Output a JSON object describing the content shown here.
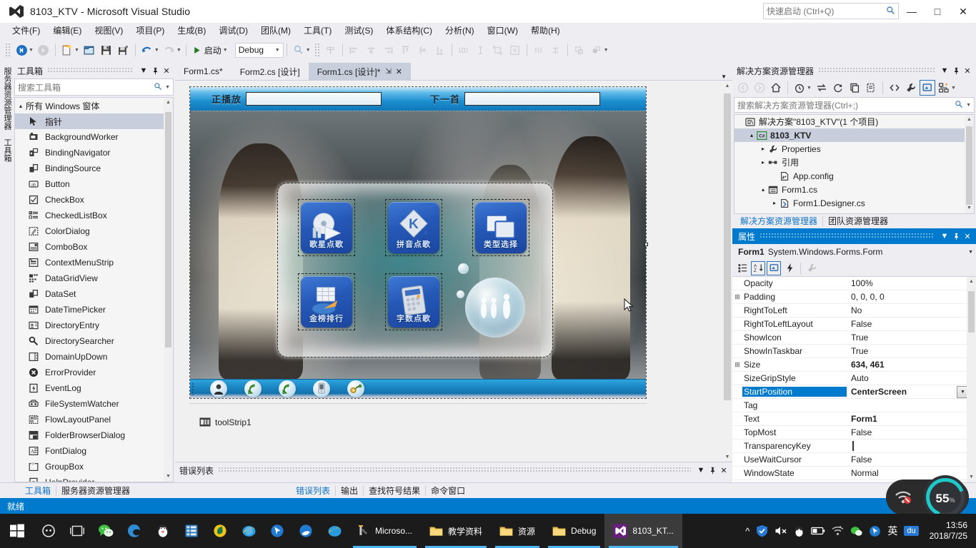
{
  "titlebar": {
    "title": "8103_KTV - Microsoft Visual Studio",
    "quick_launch_placeholder": "快速启动 (Ctrl+Q)",
    "minimize": "—",
    "maximize": "□",
    "close": "✕"
  },
  "menubar": {
    "items": [
      {
        "label": "文件(F)"
      },
      {
        "label": "编辑(E)"
      },
      {
        "label": "视图(V)"
      },
      {
        "label": "项目(P)"
      },
      {
        "label": "生成(B)"
      },
      {
        "label": "调试(D)"
      },
      {
        "label": "团队(M)"
      },
      {
        "label": "工具(T)"
      },
      {
        "label": "测试(S)"
      },
      {
        "label": "体系结构(C)"
      },
      {
        "label": "分析(N)"
      },
      {
        "label": "窗口(W)"
      },
      {
        "label": "帮助(H)"
      }
    ]
  },
  "toolbar": {
    "start_label": "启动",
    "config_value": "Debug"
  },
  "vertical_tabs": [
    {
      "label": "服务器资源管理器"
    },
    {
      "label": "工具箱"
    }
  ],
  "toolbox": {
    "title": "工具箱",
    "search_placeholder": "搜索工具箱",
    "group_label": "所有 Windows 窗体",
    "items": [
      {
        "label": "指针",
        "icon": "pointer-icon",
        "selected": true
      },
      {
        "label": "BackgroundWorker",
        "icon": "backgroundworker-icon"
      },
      {
        "label": "BindingNavigator",
        "icon": "bindingnavigator-icon"
      },
      {
        "label": "BindingSource",
        "icon": "bindingsource-icon"
      },
      {
        "label": "Button",
        "icon": "button-icon"
      },
      {
        "label": "CheckBox",
        "icon": "checkbox-icon"
      },
      {
        "label": "CheckedListBox",
        "icon": "checkedlistbox-icon"
      },
      {
        "label": "ColorDialog",
        "icon": "colordialog-icon"
      },
      {
        "label": "ComboBox",
        "icon": "combobox-icon"
      },
      {
        "label": "ContextMenuStrip",
        "icon": "contextmenustrip-icon"
      },
      {
        "label": "DataGridView",
        "icon": "datagridview-icon"
      },
      {
        "label": "DataSet",
        "icon": "dataset-icon"
      },
      {
        "label": "DateTimePicker",
        "icon": "datetimepicker-icon"
      },
      {
        "label": "DirectoryEntry",
        "icon": "directoryentry-icon"
      },
      {
        "label": "DirectorySearcher",
        "icon": "directorysearcher-icon"
      },
      {
        "label": "DomainUpDown",
        "icon": "domainupdown-icon"
      },
      {
        "label": "ErrorProvider",
        "icon": "errorprovider-icon"
      },
      {
        "label": "EventLog",
        "icon": "eventlog-icon"
      },
      {
        "label": "FileSystemWatcher",
        "icon": "filesystemwatcher-icon"
      },
      {
        "label": "FlowLayoutPanel",
        "icon": "flowlayoutpanel-icon"
      },
      {
        "label": "FolderBrowserDialog",
        "icon": "folderbrowserdialog-icon"
      },
      {
        "label": "FontDialog",
        "icon": "fontdialog-icon"
      },
      {
        "label": "GroupBox",
        "icon": "groupbox-icon"
      },
      {
        "label": "HelpProvider",
        "icon": "helpprovider-icon"
      }
    ]
  },
  "doctabs": [
    {
      "label": "Form1.cs*",
      "active": false
    },
    {
      "label": "Form2.cs [设计]",
      "active": false
    },
    {
      "label": "Form1.cs [设计]*",
      "active": true
    }
  ],
  "designer": {
    "form": {
      "now_playing_label": "正播放",
      "now_playing_value": "",
      "next_song_label": "下一首",
      "next_song_value": "",
      "menu_buttons": [
        {
          "caption": "歌星点歌",
          "icon": "disc-play-icon"
        },
        {
          "caption": "拼音点歌",
          "icon": "k-diamond-icon"
        },
        {
          "caption": "类型选择",
          "icon": "windows-stack-icon"
        },
        {
          "caption": "金榜排行",
          "icon": "chart-pie-icon"
        },
        {
          "caption": "字数点歌",
          "icon": "calculator-icon"
        }
      ],
      "bottom_buttons": [
        {
          "icon": "singer-avatar-icon"
        },
        {
          "icon": "green-arrow-left-icon"
        },
        {
          "icon": "green-arrow-left2-icon"
        },
        {
          "icon": "remote-device-icon"
        },
        {
          "icon": "key-gold-icon"
        }
      ]
    },
    "tray_component": "toolStrip1"
  },
  "errorlist": {
    "title": "错误列表"
  },
  "bottom_tabs": {
    "left": [
      {
        "label": "工具箱",
        "active": true
      },
      {
        "label": "服务器资源管理器",
        "active": false
      }
    ],
    "right": [
      {
        "label": "错误列表",
        "active": true
      },
      {
        "label": "输出",
        "active": false
      },
      {
        "label": "查找符号结果",
        "active": false
      },
      {
        "label": "命令窗口",
        "active": false
      }
    ]
  },
  "statusbar": {
    "text": "就绪"
  },
  "solution_explorer": {
    "title": "解决方案资源管理器",
    "search_placeholder": "搜索解决方案资源管理器(Ctrl+;)",
    "tree": [
      {
        "label": "解决方案\"8103_KTV\"(1 个项目)",
        "indent": 0,
        "tri": "",
        "icon": "solution-icon",
        "selected": false
      },
      {
        "label": "8103_KTV",
        "indent": 1,
        "tri": "▴",
        "icon": "csharp-project-icon",
        "selected": true
      },
      {
        "label": "Properties",
        "indent": 2,
        "tri": "▸",
        "icon": "wrench-icon",
        "selected": false
      },
      {
        "label": "引用",
        "indent": 2,
        "tri": "▸",
        "icon": "references-icon",
        "selected": false
      },
      {
        "label": "App.config",
        "indent": 3,
        "tri": "",
        "icon": "config-file-icon",
        "selected": false
      },
      {
        "label": "Form1.cs",
        "indent": 2,
        "tri": "▴",
        "icon": "form-file-icon",
        "selected": false
      },
      {
        "label": "Form1.Designer.cs",
        "indent": 3,
        "tri": "▸",
        "icon": "csharp-file-icon",
        "selected": false
      }
    ],
    "tabs": [
      {
        "label": "解决方案资源管理器",
        "active": true
      },
      {
        "label": "团队资源管理器",
        "active": false
      }
    ]
  },
  "properties": {
    "title": "属性",
    "object_name": "Form1",
    "object_type": "System.Windows.Forms.Form",
    "rows": [
      {
        "name": "Opacity",
        "value": "100%",
        "expand": "",
        "selected": false,
        "bold": false
      },
      {
        "name": "Padding",
        "value": "0, 0, 0, 0",
        "expand": "⊞",
        "selected": false,
        "bold": false
      },
      {
        "name": "RightToLeft",
        "value": "No",
        "expand": "",
        "selected": false,
        "bold": false
      },
      {
        "name": "RightToLeftLayout",
        "value": "False",
        "expand": "",
        "selected": false,
        "bold": false
      },
      {
        "name": "ShowIcon",
        "value": "True",
        "expand": "",
        "selected": false,
        "bold": false
      },
      {
        "name": "ShowInTaskbar",
        "value": "True",
        "expand": "",
        "selected": false,
        "bold": false
      },
      {
        "name": "Size",
        "value": "634, 461",
        "expand": "⊞",
        "selected": false,
        "bold": true
      },
      {
        "name": "SizeGripStyle",
        "value": "Auto",
        "expand": "",
        "selected": false,
        "bold": false
      },
      {
        "name": "StartPosition",
        "value": "CenterScreen",
        "expand": "",
        "selected": true,
        "bold": true,
        "dropdown": true
      },
      {
        "name": "Tag",
        "value": "",
        "expand": "",
        "selected": false,
        "bold": false
      },
      {
        "name": "Text",
        "value": "Form1",
        "expand": "",
        "selected": false,
        "bold": true
      },
      {
        "name": "TopMost",
        "value": "False",
        "expand": "",
        "selected": false,
        "bold": false
      },
      {
        "name": "TransparencyKey",
        "value": "",
        "expand": "",
        "selected": false,
        "bold": false,
        "swatch": "#ffffff"
      },
      {
        "name": "UseWaitCursor",
        "value": "False",
        "expand": "",
        "selected": false,
        "bold": false
      },
      {
        "name": "WindowState",
        "value": "Normal",
        "expand": "",
        "selected": false,
        "bold": false
      }
    ]
  },
  "speed_widget": {
    "value": "55",
    "unit": "%",
    "accent": "#20c9c9"
  },
  "taskbar": {
    "pinned": [
      {
        "icon": "windows-start-icon"
      },
      {
        "icon": "cortana-icon"
      },
      {
        "icon": "task-view-icon"
      },
      {
        "icon": "wechat-icon"
      },
      {
        "icon": "edge-icon"
      },
      {
        "icon": "qq-icon"
      },
      {
        "icon": "media-player-icon"
      },
      {
        "icon": "yellow-leaf-icon"
      },
      {
        "icon": "ie-icon"
      },
      {
        "icon": "blue-cursor-icon"
      },
      {
        "icon": "qq-browser-icon"
      },
      {
        "icon": "ie-icon-2"
      }
    ],
    "tasks": [
      {
        "label": "Microso...",
        "icon": "visual-studio-task-icon",
        "active": false
      },
      {
        "label": "教学资料",
        "icon": "folder-icon",
        "active": false
      },
      {
        "label": "资源",
        "icon": "folder-icon",
        "active": false
      },
      {
        "label": "Debug",
        "icon": "folder-icon",
        "active": false
      },
      {
        "label": "8103_KT...",
        "icon": "visual-studio-icon",
        "active": true
      }
    ],
    "tray": [
      {
        "icon": "chevron-up-icon"
      },
      {
        "icon": "shield-security-icon"
      },
      {
        "icon": "volume-muted-icon"
      },
      {
        "icon": "qq-panda-icon"
      },
      {
        "icon": "battery-icon"
      },
      {
        "icon": "wifi-icon"
      },
      {
        "icon": "wechat-tray-icon"
      },
      {
        "icon": "cursor-tray-icon"
      },
      {
        "icon": "ime-chinese-icon"
      },
      {
        "icon": "baidu-icon"
      }
    ],
    "ime_label": "英",
    "baidu_label": "du",
    "clock_time": "13:56",
    "clock_date": "2018/7/25"
  }
}
